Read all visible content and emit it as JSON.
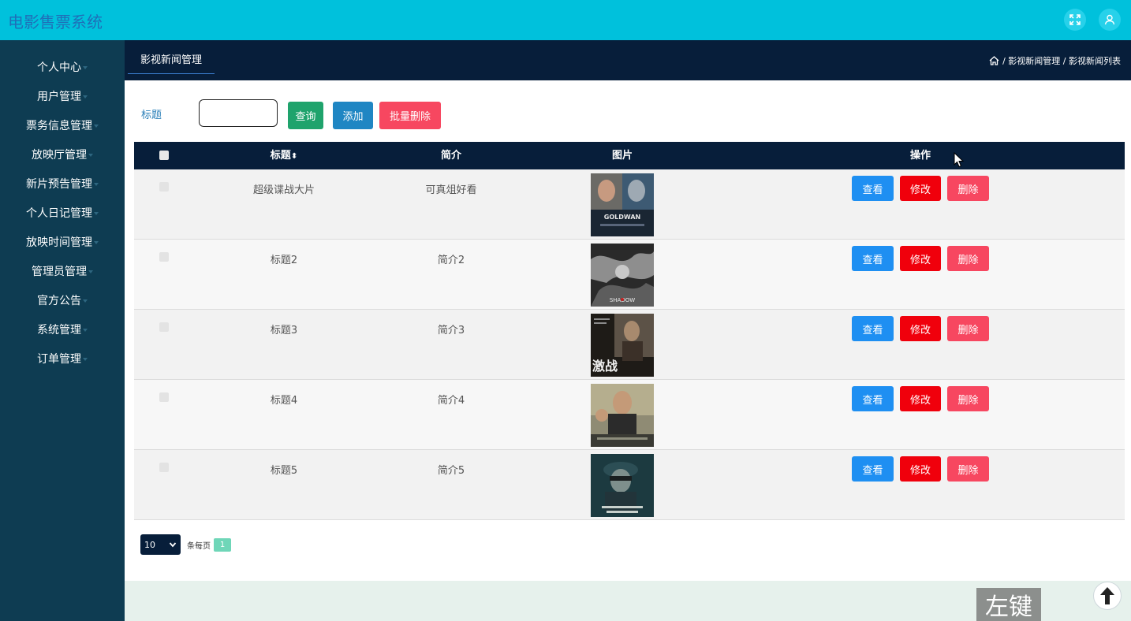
{
  "app": {
    "title": "电影售票系统"
  },
  "header": {
    "fullscreen_icon": "expand-icon",
    "user_icon": "user-icon"
  },
  "sidebar": {
    "items": [
      {
        "label": "个人中心"
      },
      {
        "label": "用户管理"
      },
      {
        "label": "票务信息管理"
      },
      {
        "label": "放映厅管理"
      },
      {
        "label": "新片预告管理"
      },
      {
        "label": "个人日记管理"
      },
      {
        "label": "放映时间管理"
      },
      {
        "label": "管理员管理"
      },
      {
        "label": "官方公告"
      },
      {
        "label": "系统管理"
      },
      {
        "label": "订单管理"
      }
    ]
  },
  "subheader": {
    "tab": "影视新闻管理",
    "breadcrumb": "/ 影视新闻管理 / 影视新闻列表"
  },
  "search": {
    "label": "标题",
    "value": "",
    "query_label": "查询",
    "add_label": "添加",
    "bulk_delete_label": "批量删除"
  },
  "table": {
    "headers": {
      "title": "标题",
      "intro": "简介",
      "image": "图片",
      "actions": "操作"
    },
    "rows": [
      {
        "title": "超级谍战大片",
        "intro": "可真俎好看",
        "poster": "GOLDWAN"
      },
      {
        "title": "标题2",
        "intro": "简介2",
        "poster": "SHADOW"
      },
      {
        "title": "标题3",
        "intro": "简介3",
        "poster": "激战"
      },
      {
        "title": "标题4",
        "intro": "简介4",
        "poster": ""
      },
      {
        "title": "标题5",
        "intro": "简介5",
        "poster": ""
      }
    ],
    "actions": {
      "view": "查看",
      "edit": "修改",
      "delete": "删除"
    }
  },
  "pagination": {
    "page_size": "10",
    "per_page_label": "条每页",
    "current_page": "1"
  },
  "overlay": {
    "key_hint": "左键"
  },
  "colors": {
    "topbar": "#00c1dc",
    "sidebar": "#0e3c52",
    "header_dark": "#071e3a",
    "view": "#1e8ff2",
    "edit": "#f0000c",
    "delete": "#f74760",
    "query": "#1fa36c",
    "add": "#1f86c3"
  }
}
